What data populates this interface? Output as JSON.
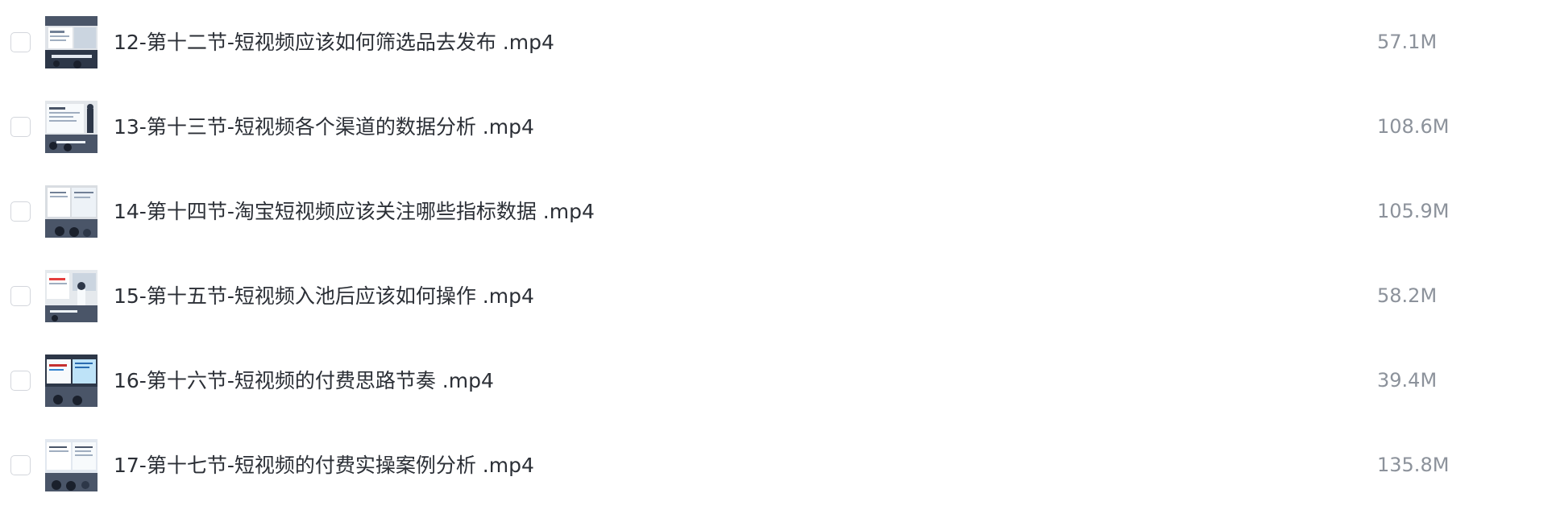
{
  "files": [
    {
      "name": "12-第十二节-短视频应该如何筛选品去发布 .mp4",
      "size": "57.1M",
      "thumb_icon": "video-thumbnail-icon"
    },
    {
      "name": "13-第十三节-短视频各个渠道的数据分析 .mp4",
      "size": "108.6M",
      "thumb_icon": "video-thumbnail-icon"
    },
    {
      "name": "14-第十四节-淘宝短视频应该关注哪些指标数据 .mp4",
      "size": "105.9M",
      "thumb_icon": "video-thumbnail-icon"
    },
    {
      "name": "15-第十五节-短视频入池后应该如何操作 .mp4",
      "size": "58.2M",
      "thumb_icon": "video-thumbnail-icon"
    },
    {
      "name": "16-第十六节-短视频的付费思路节奏 .mp4",
      "size": "39.4M",
      "thumb_icon": "video-thumbnail-icon"
    },
    {
      "name": "17-第十七节-短视频的付费实操案例分析 .mp4",
      "size": "135.8M",
      "thumb_icon": "video-thumbnail-icon"
    }
  ],
  "colors": {
    "text": "#2b2f36",
    "size_text": "#8c929b",
    "checkbox_border": "#d3d6dc"
  }
}
